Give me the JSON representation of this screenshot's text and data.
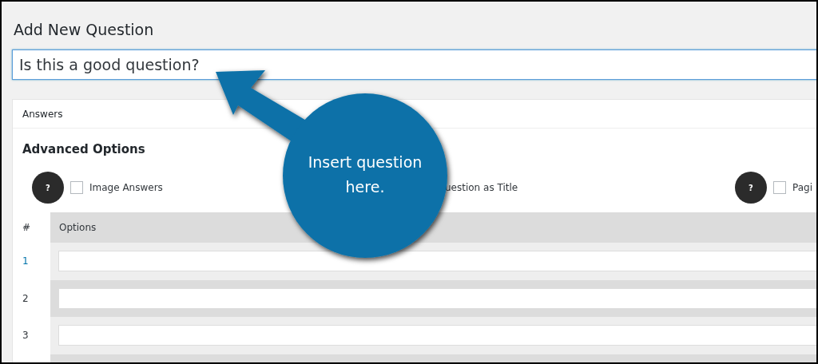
{
  "page_title": "Add New Question",
  "question_field": {
    "value": "Is this a good question?"
  },
  "panel": {
    "title": "Answers",
    "section_title": "Advanced Options",
    "options": [
      {
        "kind": "checkbox",
        "help": "?",
        "label": "Image Answers",
        "checked": false
      },
      {
        "kind": "text",
        "label": "uestion as Title"
      },
      {
        "kind": "checkbox",
        "help": "?",
        "label": "Pagi",
        "checked": false
      }
    ],
    "table": {
      "columns": [
        "#",
        "Options"
      ],
      "rows": [
        {
          "number": "1",
          "selected": true
        },
        {
          "number": "2",
          "selected": false
        },
        {
          "number": "3",
          "selected": false
        }
      ]
    }
  },
  "callout": {
    "lines": [
      "Insert question",
      "here."
    ]
  }
}
